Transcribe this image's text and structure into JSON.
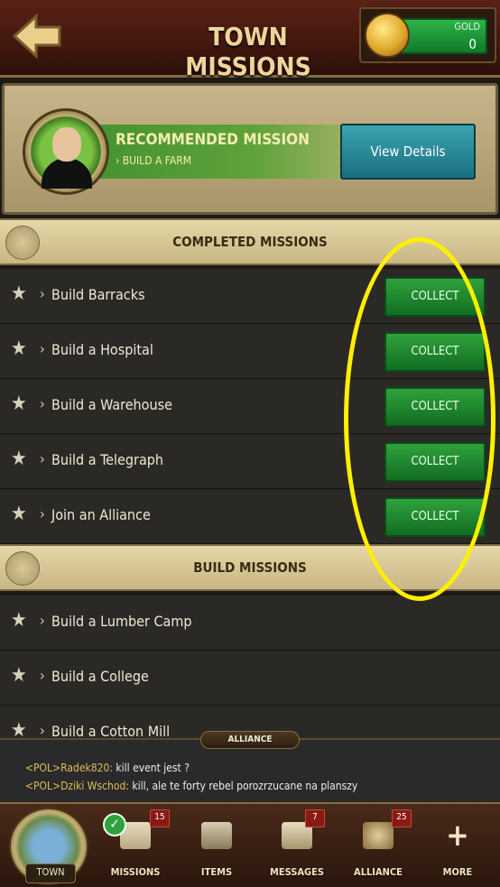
{
  "header": {
    "title": "TOWN MISSIONS",
    "back_icon": "back-arrow-icon",
    "gold": {
      "label": "GOLD",
      "value": "0"
    }
  },
  "recommended": {
    "title": "RECOMMENDED MISSION",
    "subtitle": "› BUILD A FARM",
    "button_label": "View Details"
  },
  "completed": {
    "heading": "COMPLETED MISSIONS",
    "items": [
      {
        "label": "Build Barracks",
        "button": "COLLECT"
      },
      {
        "label": "Build a Hospital",
        "button": "COLLECT"
      },
      {
        "label": "Build a Warehouse",
        "button": "COLLECT"
      },
      {
        "label": "Build a Telegraph",
        "button": "COLLECT"
      },
      {
        "label": "Join an Alliance",
        "button": "COLLECT"
      }
    ]
  },
  "build": {
    "heading": "BUILD MISSIONS",
    "items": [
      {
        "label": "Build a Lumber Camp"
      },
      {
        "label": "Build a College"
      },
      {
        "label": "Build a Cotton Mill"
      }
    ]
  },
  "chat": {
    "tab": "ALLIANCE",
    "messages": [
      {
        "name": "<POL>Radek820:",
        "text": "kill event jest ?"
      },
      {
        "name": "<POL>Dziki Wschod:",
        "text": "kill, ale te forty rebel porozrzucane na planszy"
      }
    ]
  },
  "nav": {
    "town": "TOWN",
    "items": [
      {
        "label": "MISSIONS",
        "badge": "15"
      },
      {
        "label": "ITEMS",
        "badge": ""
      },
      {
        "label": "MESSAGES",
        "badge": "7"
      },
      {
        "label": "ALLIANCE",
        "badge": "25"
      },
      {
        "label": "MORE",
        "badge": ""
      }
    ]
  },
  "colors": {
    "highlight": "#ffef00",
    "collect": "#2fa23c",
    "details": "#1c6f80"
  }
}
